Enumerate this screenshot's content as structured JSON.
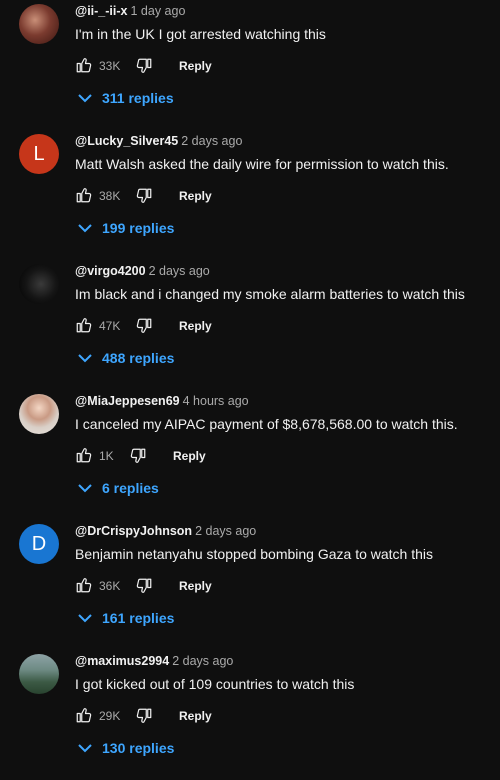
{
  "comments": [
    {
      "author": "@ii-_-ii-x",
      "time": "1 day ago",
      "text": "I'm in the UK I got arrested watching this",
      "likes": "33K",
      "reply_label": "Reply",
      "replies": "311 replies",
      "avatar_letter": ""
    },
    {
      "author": "@Lucky_Silver45",
      "time": "2 days ago",
      "text": "Matt Walsh asked the daily wire for permission to watch this.",
      "likes": "38K",
      "reply_label": "Reply",
      "replies": "199 replies",
      "avatar_letter": "L"
    },
    {
      "author": "@virgo4200",
      "time": "2 days ago",
      "text": "Im black and i changed my smoke alarm batteries to watch this",
      "likes": "47K",
      "reply_label": "Reply",
      "replies": "488 replies",
      "avatar_letter": ""
    },
    {
      "author": "@MiaJeppesen69",
      "time": "4 hours ago",
      "text": "I canceled my AIPAC payment of $8,678,568.00 to watch this.",
      "likes": "1K",
      "reply_label": "Reply",
      "replies": "6 replies",
      "avatar_letter": ""
    },
    {
      "author": "@DrCrispyJohnson",
      "time": "2 days ago",
      "text": "Benjamin netanyahu stopped bombing Gaza to watch this",
      "likes": "36K",
      "reply_label": "Reply",
      "replies": "161 replies",
      "avatar_letter": "D"
    },
    {
      "author": "@maximus2994",
      "time": "2 days ago",
      "text": "I got kicked out of 109 countries to watch this",
      "likes": "29K",
      "reply_label": "Reply",
      "replies": "130 replies",
      "avatar_letter": ""
    }
  ],
  "icons": {
    "like": "thumbs-up-icon",
    "dislike": "thumbs-down-icon",
    "expand": "chevron-down-icon"
  },
  "colors": {
    "background": "#0f0f0f",
    "text": "#f1f1f1",
    "secondary": "#aaaaaa",
    "replies_link": "#3ea6ff",
    "avatar_l": "#c6361a",
    "avatar_d": "#1976d2"
  }
}
